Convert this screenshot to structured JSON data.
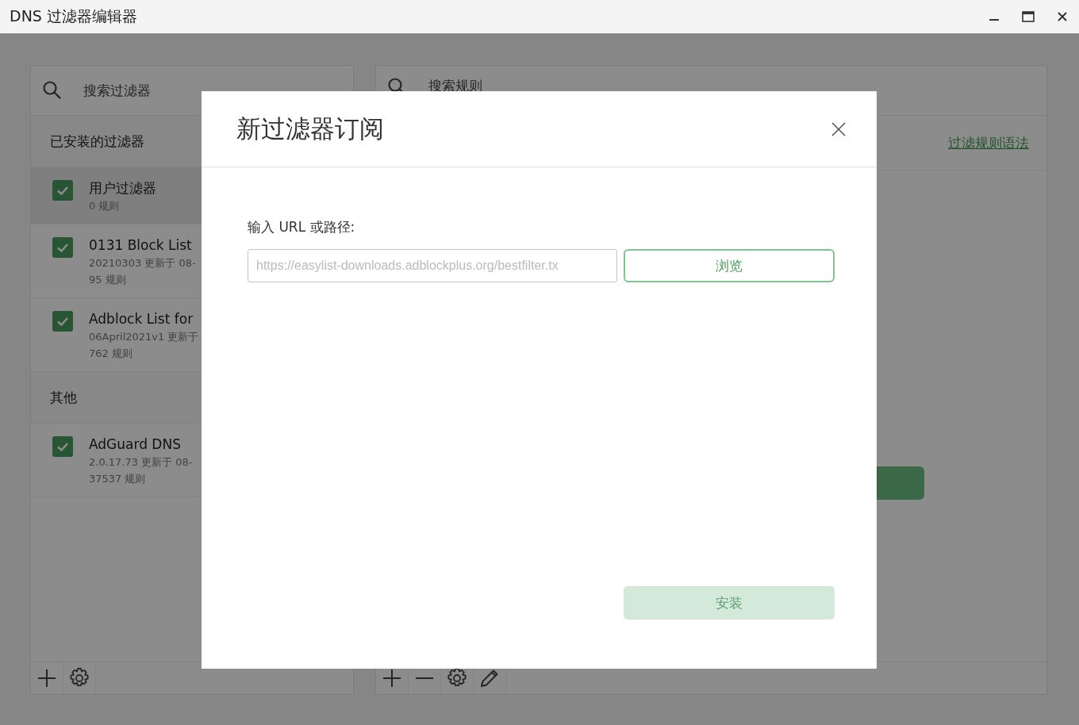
{
  "window": {
    "title": "DNS 过滤器编辑器"
  },
  "filters_panel": {
    "search": {
      "placeholder": "搜索过滤器"
    },
    "groups": [
      {
        "title": "已安装的过滤器",
        "items": [
          {
            "name": "用户过滤器",
            "lines": [
              "0 规则"
            ],
            "checked": true,
            "selected": true
          },
          {
            "name": "0131 Block List",
            "lines": [
              "20210303 更新于 08-",
              "95 规则"
            ],
            "checked": true,
            "selected": false
          },
          {
            "name": "Adblock List for",
            "lines": [
              "06April2021v1 更新于",
              "762 规则"
            ],
            "checked": true,
            "selected": false
          }
        ]
      },
      {
        "title": "其他",
        "items": [
          {
            "name": "AdGuard DNS",
            "lines": [
              "2.0.17.73 更新于 08-",
              "37537 规则"
            ],
            "checked": true,
            "selected": false
          }
        ]
      }
    ],
    "toolbar": [
      {
        "kind": "add"
      },
      {
        "kind": "settings"
      }
    ]
  },
  "rules_panel": {
    "search": {
      "placeholder": "搜索规则"
    },
    "syntax_link": "过滤规则语法",
    "toolbar": [
      {
        "kind": "add"
      },
      {
        "kind": "remove"
      },
      {
        "kind": "settings"
      },
      {
        "kind": "edit"
      }
    ]
  },
  "dialog": {
    "title": "新过滤器订阅",
    "field_label": "输入 URL 或路径:",
    "url": {
      "placeholder": "https://easylist-downloads.adblockplus.org/bestfilter.tx"
    },
    "browse_button": "浏览",
    "install_button": {
      "label": "安装",
      "disabled": true
    }
  }
}
